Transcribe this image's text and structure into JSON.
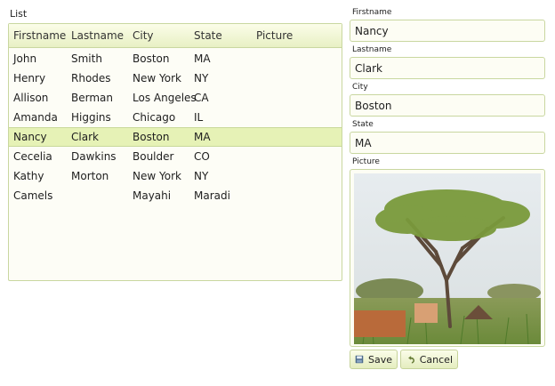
{
  "list": {
    "title": "List",
    "columns": [
      "Firstname",
      "Lastname",
      "City",
      "State",
      "Picture"
    ],
    "rows": [
      {
        "firstname": "John",
        "lastname": "Smith",
        "city": "Boston",
        "state": "MA"
      },
      {
        "firstname": "Henry",
        "lastname": "Rhodes",
        "city": "New York",
        "state": "NY"
      },
      {
        "firstname": "Allison",
        "lastname": "Berman",
        "city": "Los Angeles",
        "state": "CA"
      },
      {
        "firstname": "Amanda",
        "lastname": "Higgins",
        "city": "Chicago",
        "state": "IL"
      },
      {
        "firstname": "Nancy",
        "lastname": "Clark",
        "city": "Boston",
        "state": "MA"
      },
      {
        "firstname": "Cecelia",
        "lastname": "Dawkins",
        "city": "Boulder",
        "state": "CO"
      },
      {
        "firstname": "Kathy",
        "lastname": "Morton",
        "city": "New York",
        "state": "NY"
      },
      {
        "firstname": "Camels",
        "lastname": "",
        "city": "Mayahi",
        "state": "Maradi"
      }
    ],
    "selected_row_index": 4
  },
  "form": {
    "firstname_label": "Firstname",
    "firstname_value": "Nancy",
    "lastname_label": "Lastname",
    "lastname_value": "Clark",
    "city_label": "City",
    "city_value": "Boston",
    "state_label": "State",
    "state_value": "MA",
    "picture_label": "Picture",
    "save_label": "Save",
    "cancel_label": "Cancel"
  },
  "colors": {
    "accent_border": "#c9d7a0",
    "selected_row": "#e6f2b6",
    "header_gradient_top": "#fbfde9",
    "header_gradient_bottom": "#e8f0c4"
  },
  "icons": {
    "save": "floppy-disk-icon",
    "cancel": "undo-arrow-icon"
  }
}
